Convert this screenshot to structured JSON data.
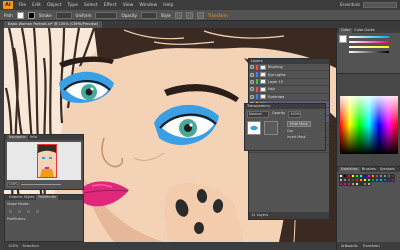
{
  "app": {
    "logo": "Ai",
    "workspace": "Essentials"
  },
  "menu": [
    "File",
    "Edit",
    "Object",
    "Type",
    "Select",
    "Effect",
    "View",
    "Window",
    "Help"
  ],
  "control_bar": {
    "selection_label": "Path",
    "stroke_label": "Stroke",
    "stroke_value": "",
    "uniform_label": "Uniform",
    "opacity_label": "Opacity",
    "style_label": "Style",
    "transform_label": "Transform"
  },
  "document": {
    "tab": "Basic Woman Portrait.ai* @ 100% (CMYK/Preview)"
  },
  "status": {
    "zoom": "100%",
    "tool": "Selection"
  },
  "layers_panel": {
    "title": "Layers",
    "rows": [
      {
        "name": "Blushing",
        "color": "#ff4a4a"
      },
      {
        "name": "Eye Lights",
        "color": "#4a7bff"
      },
      {
        "name": "Layer 15",
        "color": "#45c445"
      },
      {
        "name": "Hair",
        "color": "#ff4a4a"
      },
      {
        "name": "Eyebrows",
        "color": "#4a7bff"
      },
      {
        "name": "Lips",
        "color": "#ffb11f"
      },
      {
        "name": "Lights",
        "color": "#c44ad0"
      },
      {
        "name": "Shadows",
        "color": "#45c445"
      },
      {
        "name": "Highlights",
        "color": "#4ad0d0"
      },
      {
        "name": "Skin",
        "color": "#ff4a4a"
      },
      {
        "name": "Colours",
        "color": "#4a7bff"
      },
      {
        "name": "Reference",
        "color": "#ffb11f"
      }
    ],
    "footer": "12 Layers"
  },
  "transparency_panel": {
    "title": "Transparency",
    "mode": "Normal",
    "opacity_label": "Opacity",
    "opacity_value": "100%",
    "make_mask": "Make Mask",
    "clip": "Clip",
    "invert": "Invert Mask"
  },
  "navigator_panel": {
    "title": "Navigator",
    "tab2": "Info",
    "zoom": "100%"
  },
  "graphic_styles_panel": {
    "title": "Graphic Styles",
    "tab2": "Pathfinder",
    "shape_modes": "Shape Modes:",
    "pathfinders": "Pathfinders:"
  },
  "color_panel": {
    "title": "Color",
    "tab2": "Color Guide",
    "tab3": "Swatches"
  },
  "swatches_panel": {
    "title": "Swatches",
    "tab2": "Brushes",
    "tab3": "Symbols"
  },
  "right_bottom": {
    "tab1": "Artboards",
    "tab2": "Transform"
  },
  "colors": {
    "skin": "#f4d2b6",
    "hair": "#3a2a22",
    "eyeshadow": "#3aa0e6",
    "iris": "#4aa89a",
    "lips": "#e0287a",
    "accent_orange": "#f29a1d"
  }
}
